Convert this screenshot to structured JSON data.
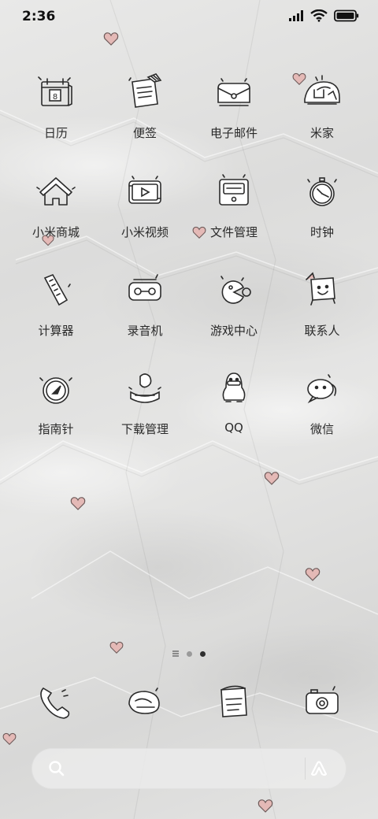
{
  "status_bar": {
    "time": "2:36",
    "icons": [
      "signal-icon",
      "wifi-icon",
      "battery-icon"
    ]
  },
  "apps": [
    {
      "label": "日历",
      "icon": "calendar-icon"
    },
    {
      "label": "便签",
      "icon": "notes-icon"
    },
    {
      "label": "电子邮件",
      "icon": "email-icon"
    },
    {
      "label": "米家",
      "icon": "mijia-icon"
    },
    {
      "label": "小米商城",
      "icon": "mi-store-icon"
    },
    {
      "label": "小米视频",
      "icon": "video-icon"
    },
    {
      "label": "文件管理",
      "icon": "file-manager-icon"
    },
    {
      "label": "时钟",
      "icon": "clock-icon"
    },
    {
      "label": "计算器",
      "icon": "calculator-icon"
    },
    {
      "label": "录音机",
      "icon": "recorder-icon"
    },
    {
      "label": "游戏中心",
      "icon": "game-center-icon"
    },
    {
      "label": "联系人",
      "icon": "contacts-icon"
    },
    {
      "label": "指南针",
      "icon": "compass-icon"
    },
    {
      "label": "下载管理",
      "icon": "downloads-icon"
    },
    {
      "label": "QQ",
      "icon": "qq-icon"
    },
    {
      "label": "微信",
      "icon": "wechat-icon"
    }
  ],
  "pager": {
    "pages": 2,
    "current": 2
  },
  "dock": [
    {
      "icon": "phone-icon"
    },
    {
      "icon": "messages-icon"
    },
    {
      "icon": "browser-icon"
    },
    {
      "icon": "camera-icon"
    }
  ],
  "search_bar": {
    "icons": [
      "search-icon",
      "assistant-icon"
    ]
  },
  "calendar_day": "8",
  "colors": {
    "heart": "#e4b9b6",
    "heart_stroke": "#6d5a59",
    "line": "#2b2b2b"
  }
}
